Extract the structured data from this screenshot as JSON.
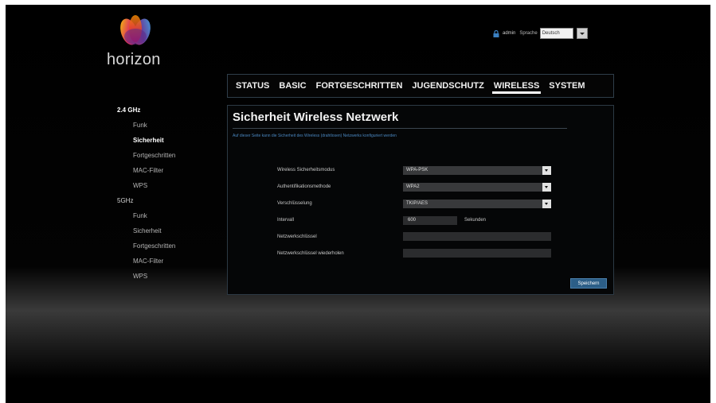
{
  "brand": {
    "logo_text": "horizon",
    "logo_icon": "horizon-flower-icon"
  },
  "topbar": {
    "lock_icon": "lock-icon",
    "user": "admin",
    "language_label": "Sprache",
    "language_value": "Deutsch"
  },
  "nav": {
    "tabs": [
      "STATUS",
      "BASIC",
      "FORTGESCHRITTEN",
      "JUGENDSCHUTZ",
      "WIRELESS",
      "SYSTEM"
    ],
    "active": "WIRELESS"
  },
  "sidebar": {
    "band1": {
      "label": "2.4 GHz",
      "items": [
        "Funk",
        "Sicherheit",
        "Fortgeschritten",
        "MAC-Filter",
        "WPS"
      ],
      "selected": "Sicherheit"
    },
    "band2": {
      "label": "5GHz",
      "items": [
        "Funk",
        "Sicherheit",
        "Fortgeschritten",
        "MAC-Filter",
        "WPS"
      ]
    }
  },
  "panel": {
    "title": "Sicherheit Wireless Netzwerk",
    "description": "Auf dieser Seite kann die Sicherheit des Wireless (drahtlosen) Netzwerks konfiguriert werden",
    "fields": {
      "mode": {
        "label": "Wireless Sicherheitsmodus",
        "value": "WPA-PSK"
      },
      "auth": {
        "label": "Authentifikationsmethode",
        "value": "WPA2"
      },
      "encryption": {
        "label": "Verschlüsselung",
        "value": "TKIP/AES"
      },
      "interval": {
        "label": "Intervall",
        "value": "600",
        "unit": "Sekunden"
      },
      "key": {
        "label": "Netzwerkschlüssel",
        "value": ""
      },
      "key_repeat": {
        "label": "Netzwerkschlüssel wiederholen",
        "value": ""
      }
    },
    "save_label": "Speichern"
  },
  "colors": {
    "accent": "#2c5e87",
    "description_text": "#4a87c0",
    "panel_border": "#2c3944"
  }
}
